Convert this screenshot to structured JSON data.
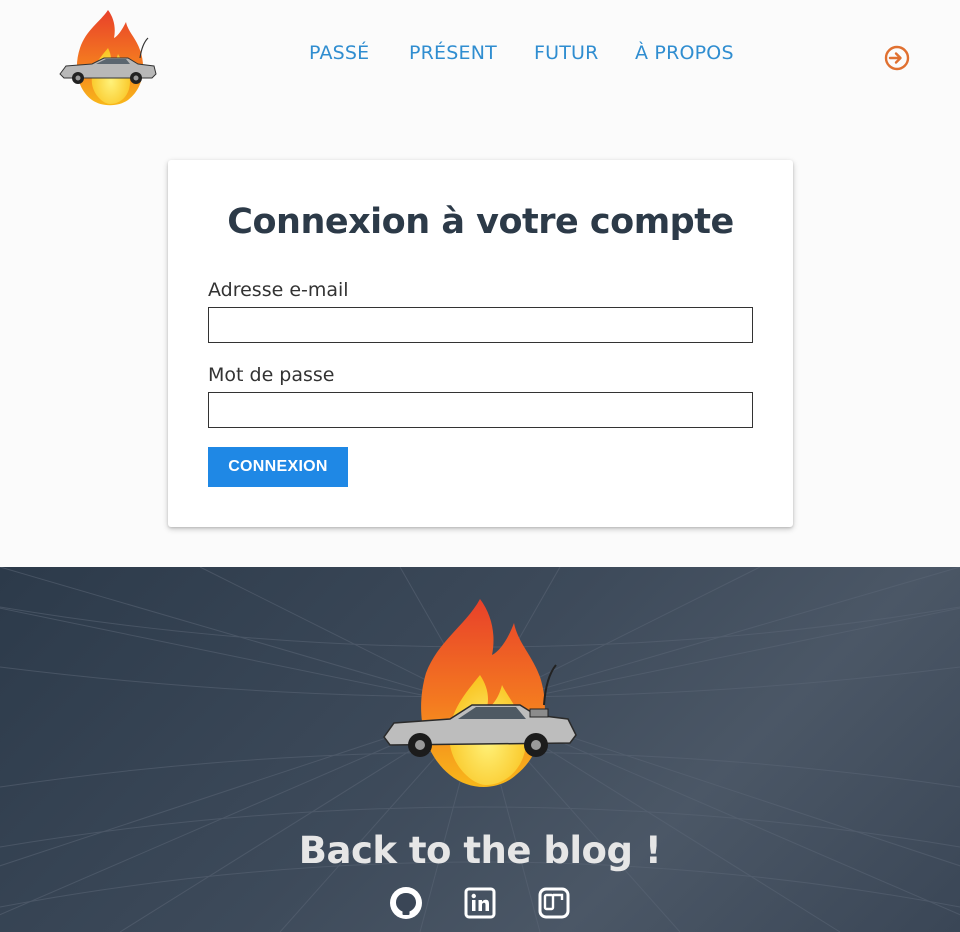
{
  "header": {
    "logo": "flame-delorean-logo",
    "nav": [
      "PASSÉ",
      "PRÉSENT",
      "FUTUR",
      "À PROPOS"
    ],
    "login_icon": "login-arrow-icon",
    "accent_color": "#2f8dd0",
    "login_color": "#e07030"
  },
  "login_card": {
    "title": "Connexion à votre compte",
    "email_label": "Adresse e-mail",
    "email_value": "",
    "password_label": "Mot de passe",
    "password_value": "",
    "submit_label": "CONNEXION",
    "button_color": "#1f88e5"
  },
  "footer": {
    "logo": "flame-delorean-logo",
    "title": "Back to the blog !",
    "social_icons": [
      "github-icon",
      "linkedin-icon",
      "blog-icon"
    ]
  }
}
